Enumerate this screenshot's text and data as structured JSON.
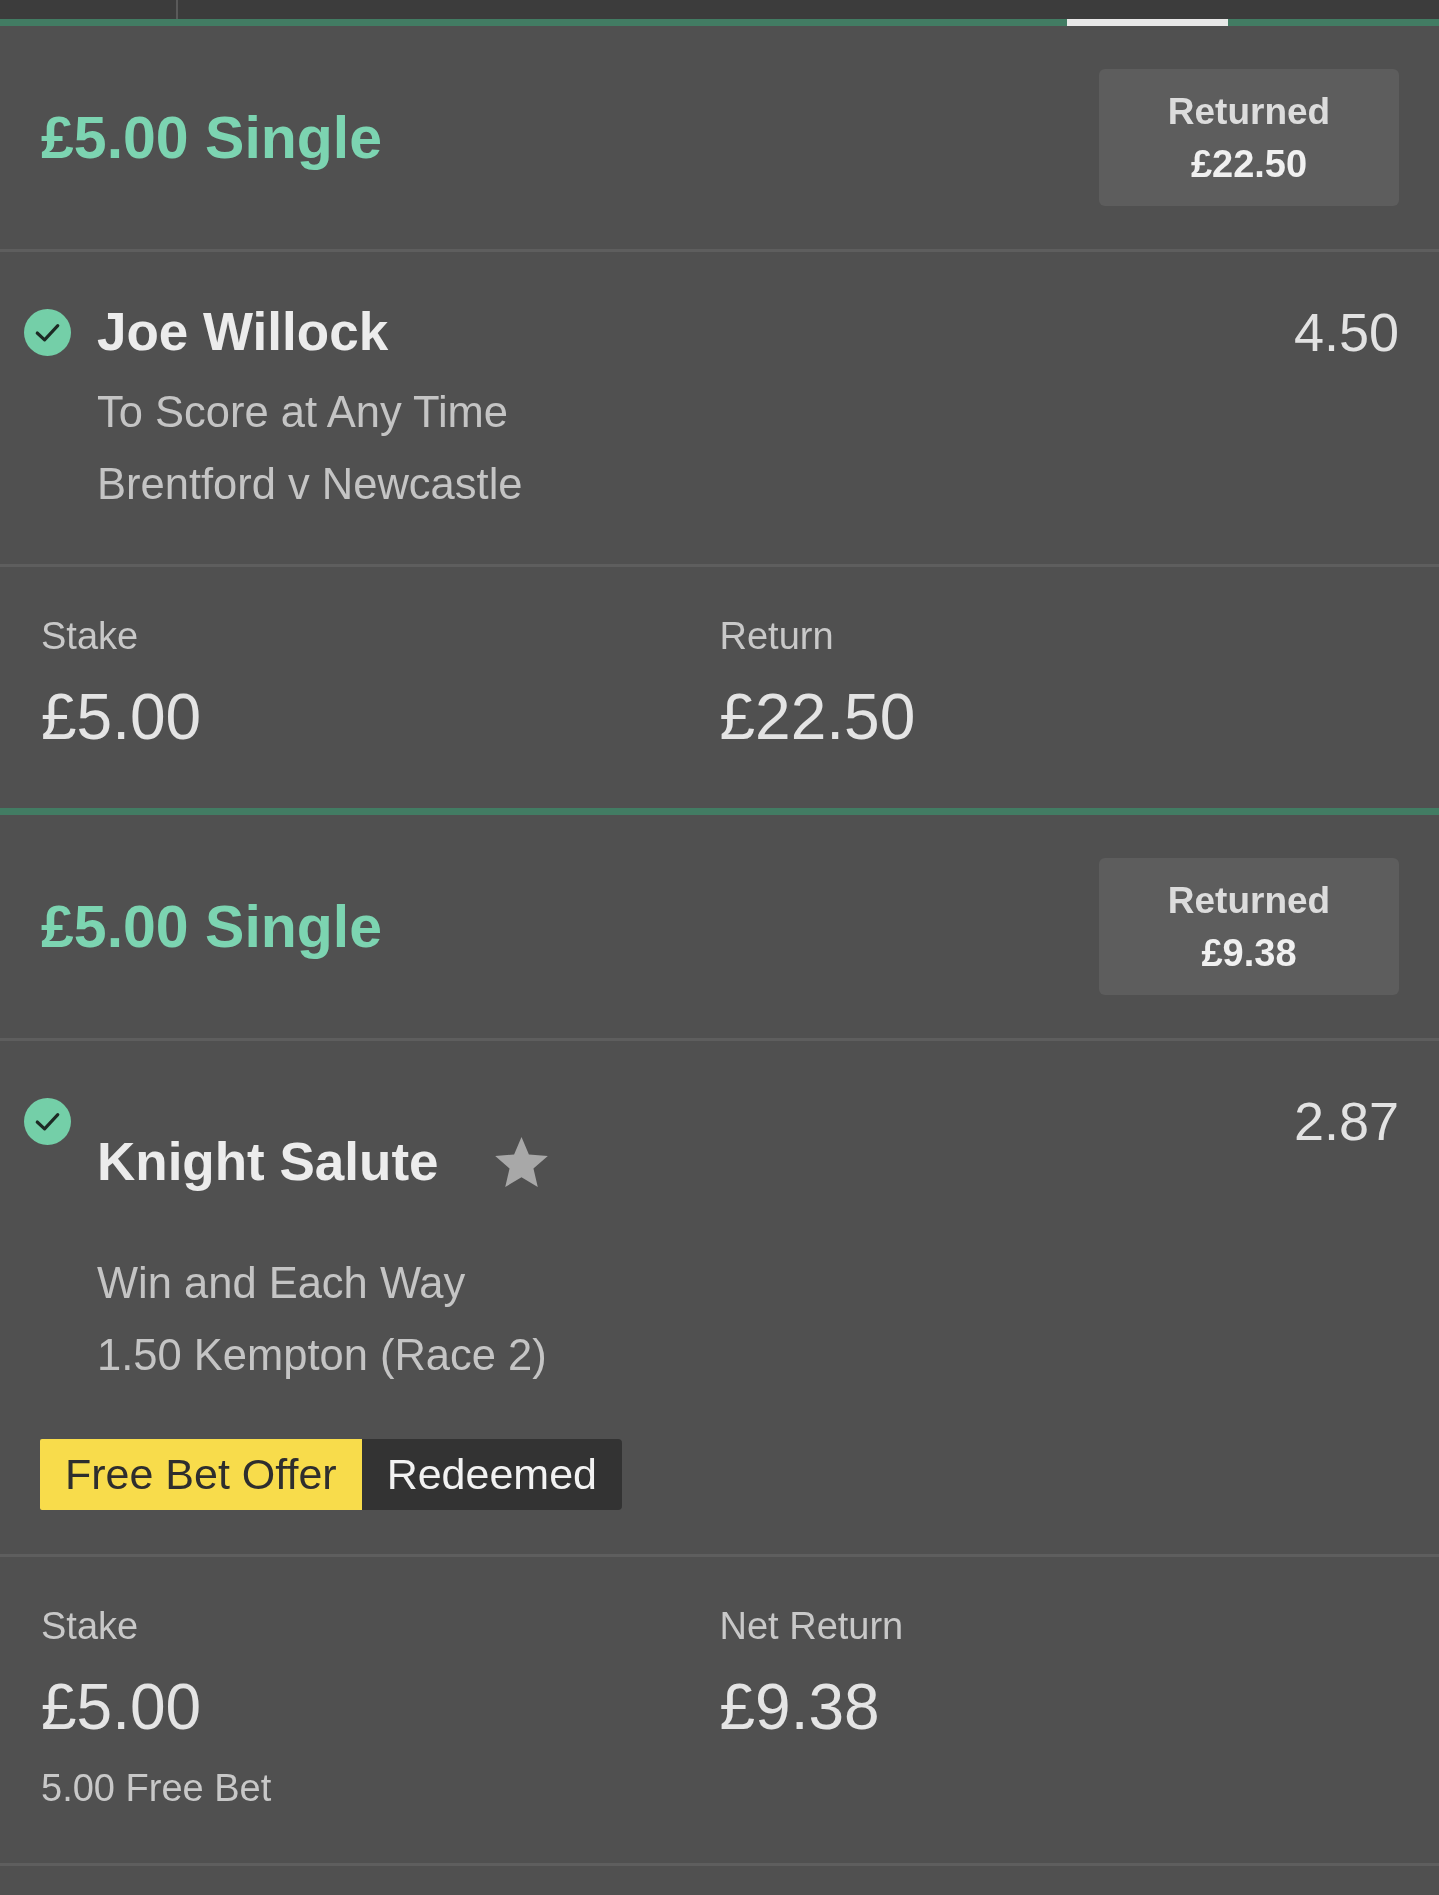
{
  "tab_bar": {
    "tabs": [
      {
        "selected": false
      },
      {
        "selected": false
      },
      {
        "selected": true
      },
      {
        "selected": false
      }
    ]
  },
  "bets": [
    {
      "title": "£5.00 Single",
      "returned_label": "Returned",
      "returned_amount": "£22.50",
      "selection": {
        "won": true,
        "name": "Joe Willock",
        "starred": false,
        "odds": "4.50",
        "market": "To Score at Any Time",
        "event": "Brentford v Newcastle"
      },
      "stake_label": "Stake",
      "stake": "£5.00",
      "return_label": "Return",
      "return": "£22.50"
    },
    {
      "title": "£5.00 Single",
      "returned_label": "Returned",
      "returned_amount": "£9.38",
      "selection": {
        "won": true,
        "name": "Knight Salute",
        "starred": true,
        "odds": "2.87",
        "market": "Win and Each Way",
        "event": "1.50 Kempton (Race 2)",
        "badges": [
          {
            "kind": "offer",
            "text": "Free Bet Offer"
          },
          {
            "kind": "status",
            "text": "Redeemed"
          }
        ]
      },
      "stake_label": "Stake",
      "stake": "£5.00",
      "stake_note": "5.00 Free Bet",
      "return_label": "Net Return",
      "return": "£9.38"
    }
  ]
}
